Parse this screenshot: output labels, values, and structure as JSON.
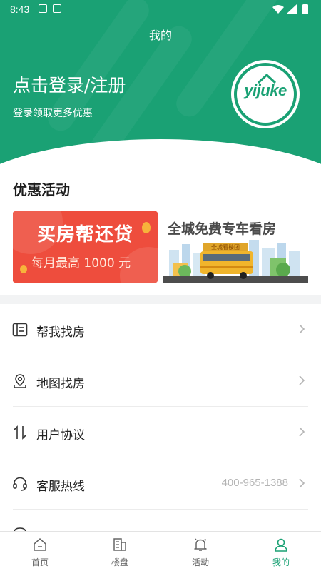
{
  "status_bar": {
    "time": "8:43"
  },
  "page_title": "我的",
  "login": {
    "title": "点击登录/注册",
    "subtitle": "登录领取更多优惠"
  },
  "logo": {
    "text": "yijuke"
  },
  "promotions": {
    "title": "优惠活动",
    "banners": [
      {
        "title": "买房帮还贷",
        "subtitle": "每月最高 1000 元"
      },
      {
        "title": "全城免费专车看房",
        "bus_sign": "全城看楼团"
      }
    ]
  },
  "menu": [
    {
      "label": "帮我找房",
      "icon": "id-card-icon",
      "value": ""
    },
    {
      "label": "地图找房",
      "icon": "map-pin-icon",
      "value": ""
    },
    {
      "label": "用户协议",
      "icon": "arrows-updown-icon",
      "value": ""
    },
    {
      "label": "客服热线",
      "icon": "headset-icon",
      "value": "400-965-1388"
    }
  ],
  "tabs": [
    {
      "label": "首页",
      "icon": "home-icon",
      "active": false
    },
    {
      "label": "楼盘",
      "icon": "building-icon",
      "active": false
    },
    {
      "label": "活动",
      "icon": "bell-icon",
      "active": false
    },
    {
      "label": "我的",
      "icon": "user-icon",
      "active": true
    }
  ],
  "colors": {
    "brand": "#1aa174",
    "promo_red": "#ee4d3d"
  }
}
